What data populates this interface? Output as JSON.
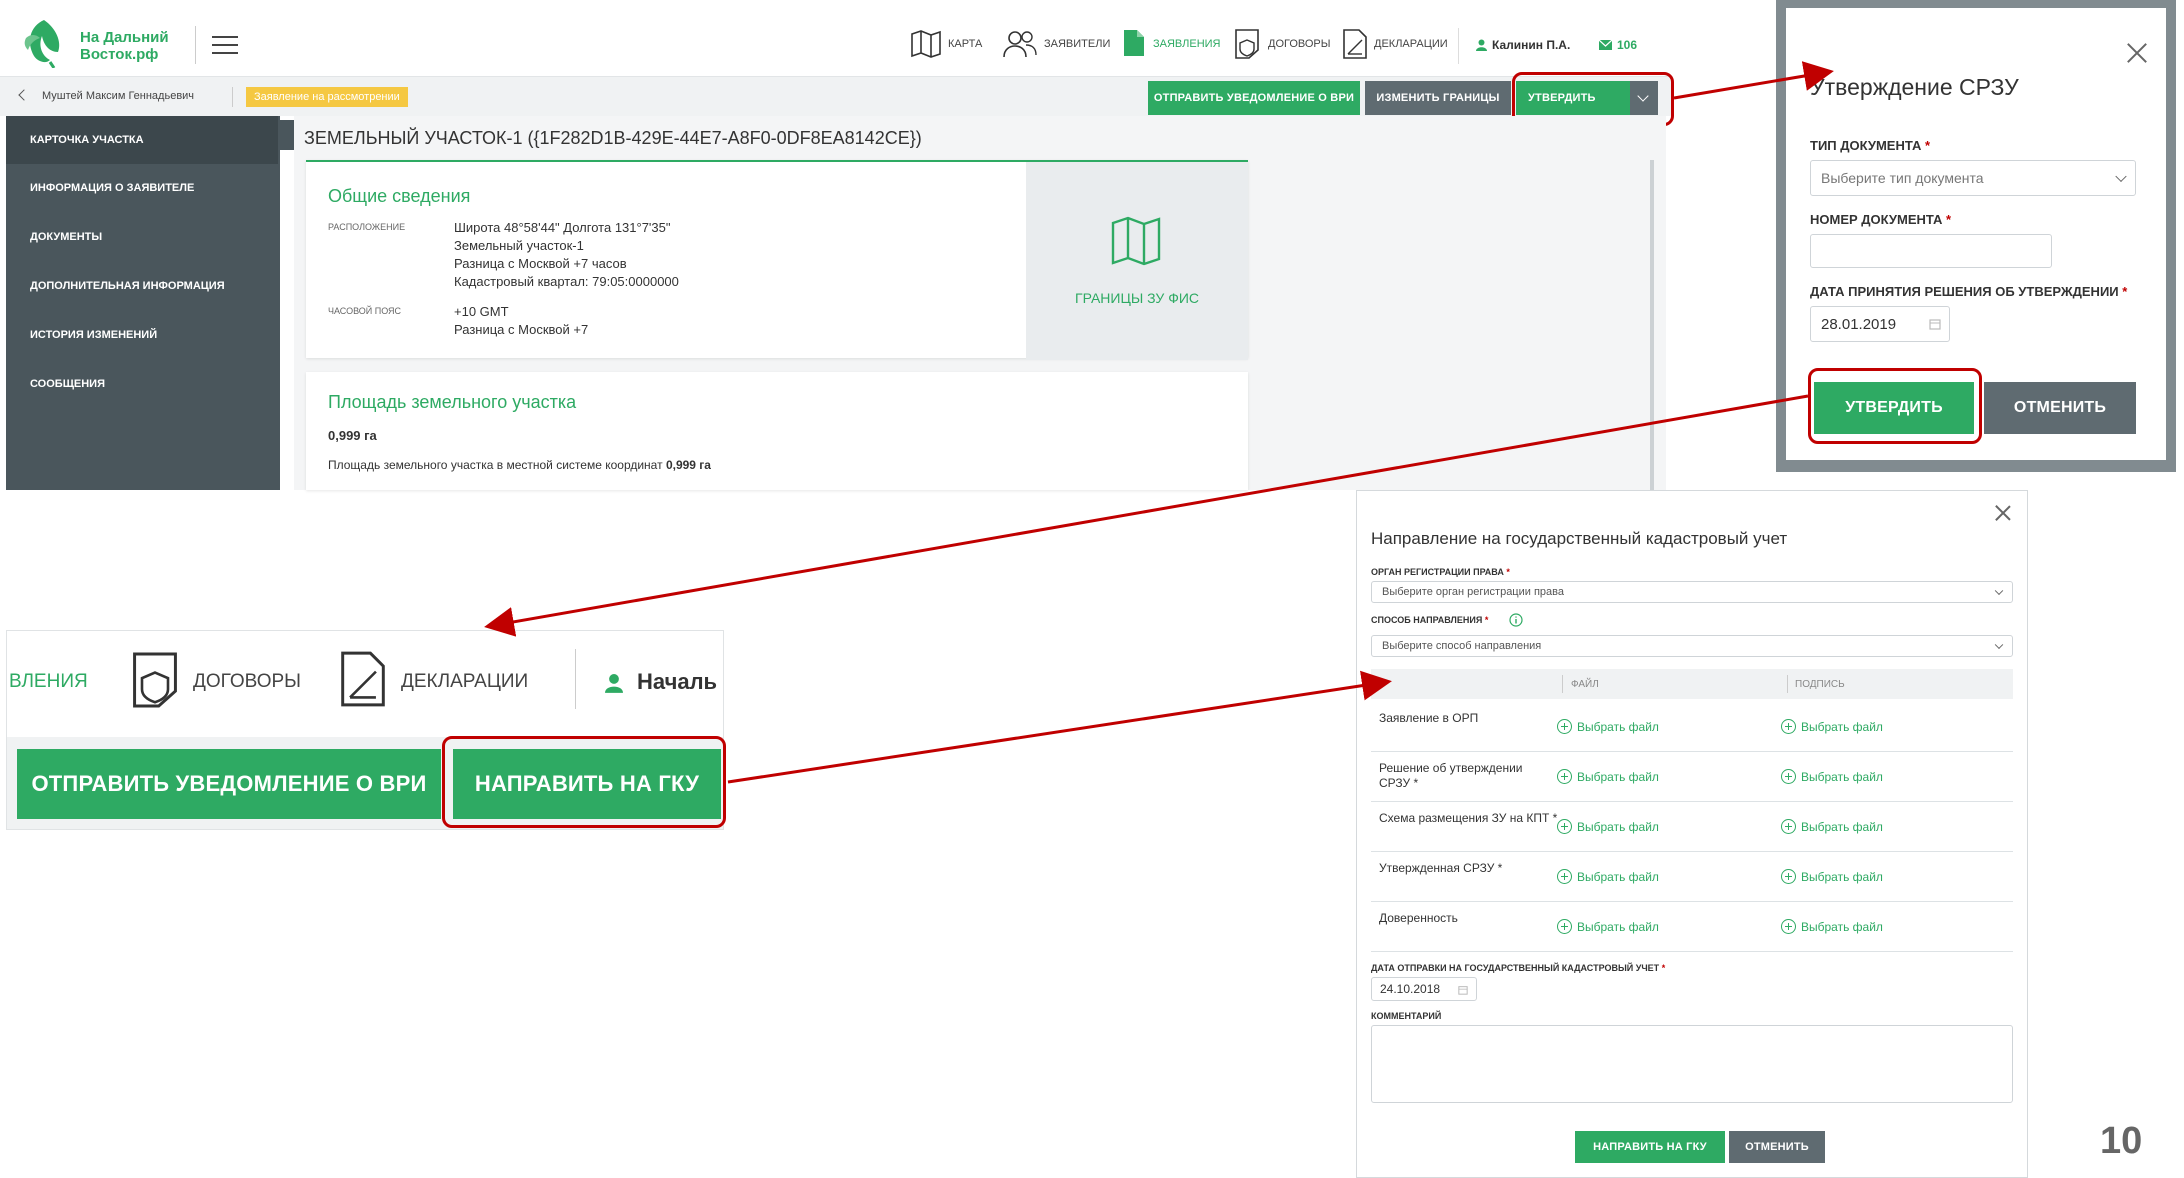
{
  "header": {
    "logo_line1": "На Дальний",
    "logo_line2": "Восток.рф",
    "nav": [
      {
        "label": "КАРТА"
      },
      {
        "label": "ЗАЯВИТЕЛИ"
      },
      {
        "label": "ЗАЯВЛЕНИЯ"
      },
      {
        "label": "ДОГОВОРЫ"
      },
      {
        "label": "ДЕКЛАРАЦИИ"
      }
    ],
    "user": "Калинин П.А.",
    "messages": "106"
  },
  "subbar": {
    "back_label": "Муштей Максим Геннадьевич",
    "status_badge": "Заявление на рассмотрении",
    "btn_notify": "ОТПРАВИТЬ УВЕДОМЛЕНИЕ О ВРИ",
    "btn_borders": "ИЗМЕНИТЬ ГРАНИЦЫ",
    "btn_approve": "УТВЕРДИТЬ"
  },
  "sidebar": {
    "items": [
      {
        "label": "КАРТОЧКА УЧАСТКА"
      },
      {
        "label": "ИНФОРМАЦИЯ О ЗАЯВИТЕЛЕ"
      },
      {
        "label": "ДОКУМЕНТЫ"
      },
      {
        "label": "ДОПОЛНИТЕЛЬНАЯ ИНФОРМАЦИЯ"
      },
      {
        "label": "ИСТОРИЯ ИЗМЕНЕНИЙ"
      },
      {
        "label": "СООБЩЕНИЯ"
      }
    ]
  },
  "main": {
    "title": "ЗЕМЕЛЬНЫЙ УЧАСТОК-1 ({1F282D1B-429E-44E7-A8F0-0DF8EA8142CE})",
    "general": {
      "heading": "Общие сведения",
      "location_label": "РАСПОЛОЖЕНИЕ",
      "location_lines": [
        "Широта 48°58'44\" Долгота 131°7'35\"",
        "Земельный участок-1",
        "Разница с Москвой +7 часов",
        "Кадастровый квартал: 79:05:0000000"
      ],
      "tz_label": "ЧАСОВОЙ ПОЯС",
      "tz_lines": [
        "+10 GMT",
        "Разница с Москвой +7"
      ],
      "map_caption": "ГРАНИЦЫ ЗУ ФИС"
    },
    "area": {
      "heading": "Площадь земельного участка",
      "value": "0,999 га",
      "local_text": "Площадь земельного участка в местной системе координат",
      "local_value": "0,999 га"
    }
  },
  "dialog_srzu": {
    "title": "Утверждение СРЗУ",
    "doc_type_label": "ТИП ДОКУМЕНТА",
    "doc_type_placeholder": "Выберите тип документа",
    "doc_number_label": "НОМЕР ДОКУМЕНТА",
    "date_label": "ДАТА ПРИНЯТИЯ РЕШЕНИЯ ОБ УТВЕРЖДЕНИИ",
    "date_value": "28.01.2019",
    "btn_approve": "УТВЕРДИТЬ",
    "btn_cancel": "ОТМЕНИТЬ"
  },
  "zoom": {
    "nav_partial": "ВЛЕНИЯ",
    "nav_contracts": "ДОГОВОРЫ",
    "nav_declarations": "ДЕКЛАРАЦИИ",
    "user_partial": "Началь",
    "btn_notify": "ОТПРАВИТЬ УВЕДОМЛЕНИЕ О ВРИ",
    "btn_gku": "НАПРАВИТЬ НА ГКУ"
  },
  "dialog_gku": {
    "title": "Направление на государственный кадастровый учет",
    "org_label": "ОРГАН РЕГИСТРАЦИИ ПРАВА",
    "org_placeholder": "Выберите орган регистрации права",
    "method_label": "СПОСОБ НАПРАВЛЕНИЯ",
    "method_placeholder": "Выберите способ направления",
    "col_file": "ФАЙЛ",
    "col_sign": "ПОДПИСЬ",
    "choose_file": "Выбрать файл",
    "rows": [
      {
        "label": "Заявление в ОРП"
      },
      {
        "label": "Решение об утверждении СРЗУ *"
      },
      {
        "label": "Схема размещения ЗУ на КПТ *"
      },
      {
        "label": "Утвержденная СРЗУ *"
      },
      {
        "label": "Доверенность"
      }
    ],
    "send_date_label": "ДАТА ОТПРАВКИ НА ГОСУДАРСТВЕННЫЙ КАДАСТРОВЫЙ УЧЕТ",
    "send_date_value": "24.10.2018",
    "comment_label": "КОММЕНТАРИЙ",
    "btn_send": "НАПРАВИТЬ НА ГКУ",
    "btn_cancel": "ОТМЕНИТЬ"
  },
  "page_number": "10",
  "colors": {
    "accent": "#2eaa63",
    "sidebar": "#4a565c",
    "highlight": "#c00000",
    "badge": "#f5c842"
  }
}
